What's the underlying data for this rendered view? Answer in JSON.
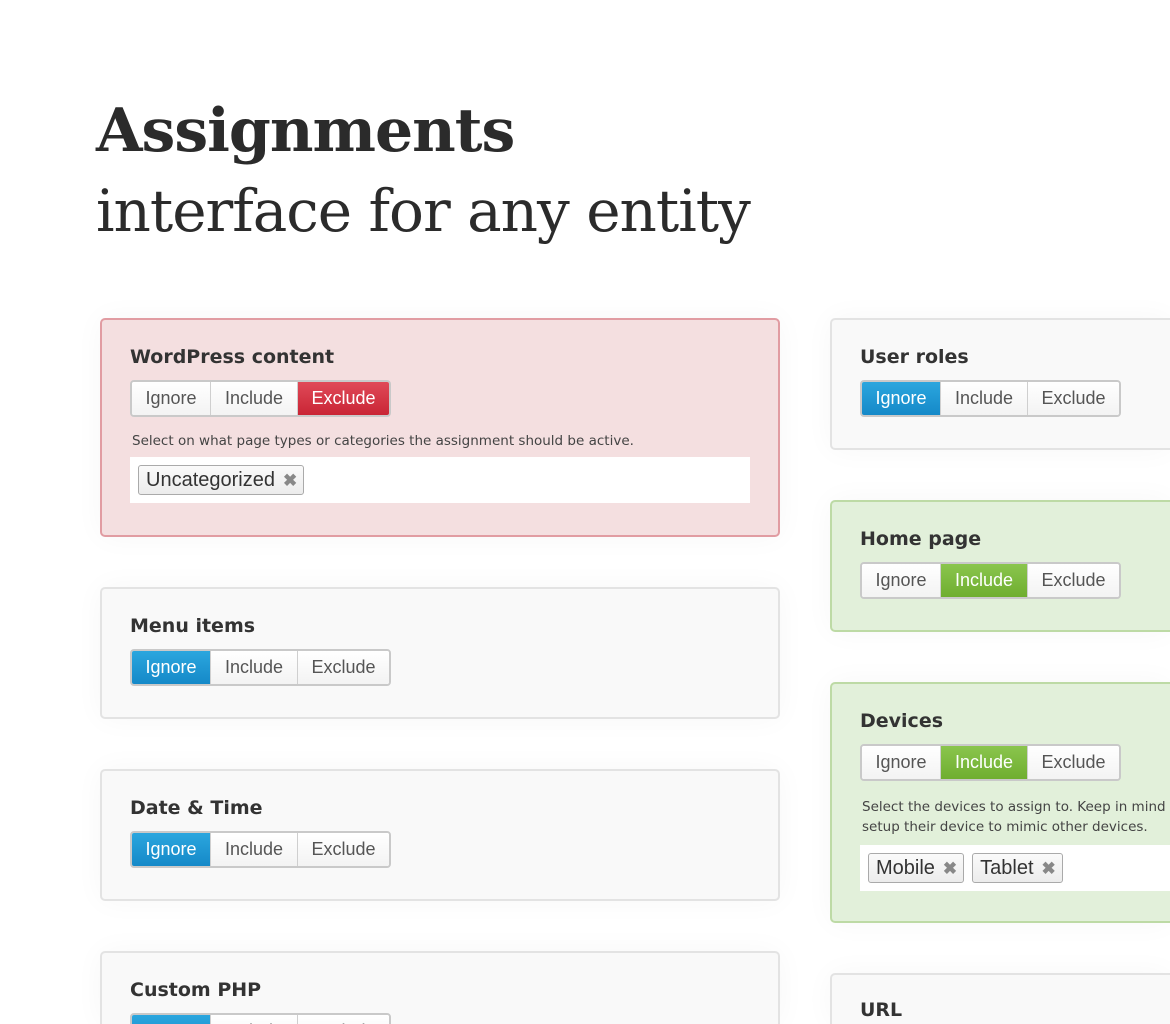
{
  "hero": {
    "title": "Assignments",
    "subtitle": "interface for any entity"
  },
  "colors": {
    "ignore_active": "#1a94d2",
    "include_active": "#7ab83c",
    "exclude_active": "#d3313f",
    "panel_exclude_bg": "#f4dfe0",
    "panel_include_bg": "#e2f0da",
    "panel_default_bg": "#f9f9f9"
  },
  "buttons": {
    "ignore": "Ignore",
    "include": "Include",
    "exclude": "Exclude"
  },
  "panels": {
    "wordpress_content": {
      "title": "WordPress content",
      "state": "Exclude",
      "description": "Select on what page types or categories the assignment should be active.",
      "tags": [
        {
          "label": "Uncategorized",
          "remove_icon": "✖"
        }
      ]
    },
    "menu_items": {
      "title": "Menu items",
      "state": "Ignore"
    },
    "date_time": {
      "title": "Date & Time",
      "state": "Ignore"
    },
    "custom_php": {
      "title": "Custom PHP",
      "state": "Ignore"
    },
    "user_roles": {
      "title": "User roles",
      "state": "Ignore"
    },
    "home_page": {
      "title": "Home page",
      "state": "Include"
    },
    "devices": {
      "title": "Devices",
      "state": "Include",
      "description_line1": "Select the devices to assign to. Keep in mind tha",
      "description_line2": "setup their device to mimic other devices.",
      "tags": [
        {
          "label": "Mobile",
          "remove_icon": "✖"
        },
        {
          "label": "Tablet",
          "remove_icon": "✖"
        }
      ]
    },
    "url": {
      "title": "URL"
    }
  }
}
